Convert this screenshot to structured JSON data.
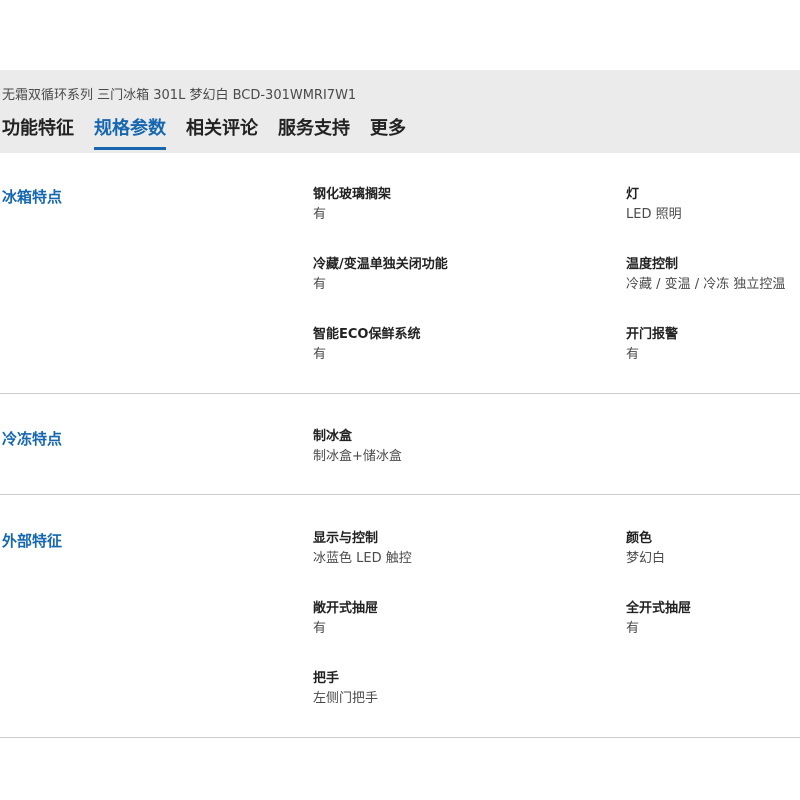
{
  "header": {
    "product_title": "无霜双循环系列 三门冰箱 301L 梦幻白 BCD-301WMRI7W1",
    "tabs": [
      {
        "label": "功能特征",
        "active": false
      },
      {
        "label": "规格参数",
        "active": true
      },
      {
        "label": "相关评论",
        "active": false
      },
      {
        "label": "服务支持",
        "active": false
      },
      {
        "label": "更多",
        "active": false
      }
    ]
  },
  "colors": {
    "accent": "#1667b0",
    "header_bg": "#ebebeb",
    "divider": "#cccccc"
  },
  "sections": [
    {
      "title": "冰箱特点",
      "specs": [
        {
          "label": "钢化玻璃搁架",
          "value": "有"
        },
        {
          "label": "灯",
          "value": "LED 照明"
        },
        {
          "label": "冷藏/变温单独关闭功能",
          "value": "有"
        },
        {
          "label": "温度控制",
          "value": "冷藏 / 变温 / 冷冻 独立控温"
        },
        {
          "label": "智能ECO保鲜系统",
          "value": "有"
        },
        {
          "label": "开门报警",
          "value": "有"
        }
      ]
    },
    {
      "title": "冷冻特点",
      "specs": [
        {
          "label": "制冰盒",
          "value": "制冰盒+储冰盒"
        }
      ]
    },
    {
      "title": "外部特征",
      "specs": [
        {
          "label": "显示与控制",
          "value": "冰蓝色 LED 触控"
        },
        {
          "label": "颜色",
          "value": "梦幻白"
        },
        {
          "label": "敞开式抽屉",
          "value": "有"
        },
        {
          "label": "全开式抽屉",
          "value": "有"
        },
        {
          "label": "把手",
          "value": "左侧门把手"
        }
      ]
    }
  ]
}
